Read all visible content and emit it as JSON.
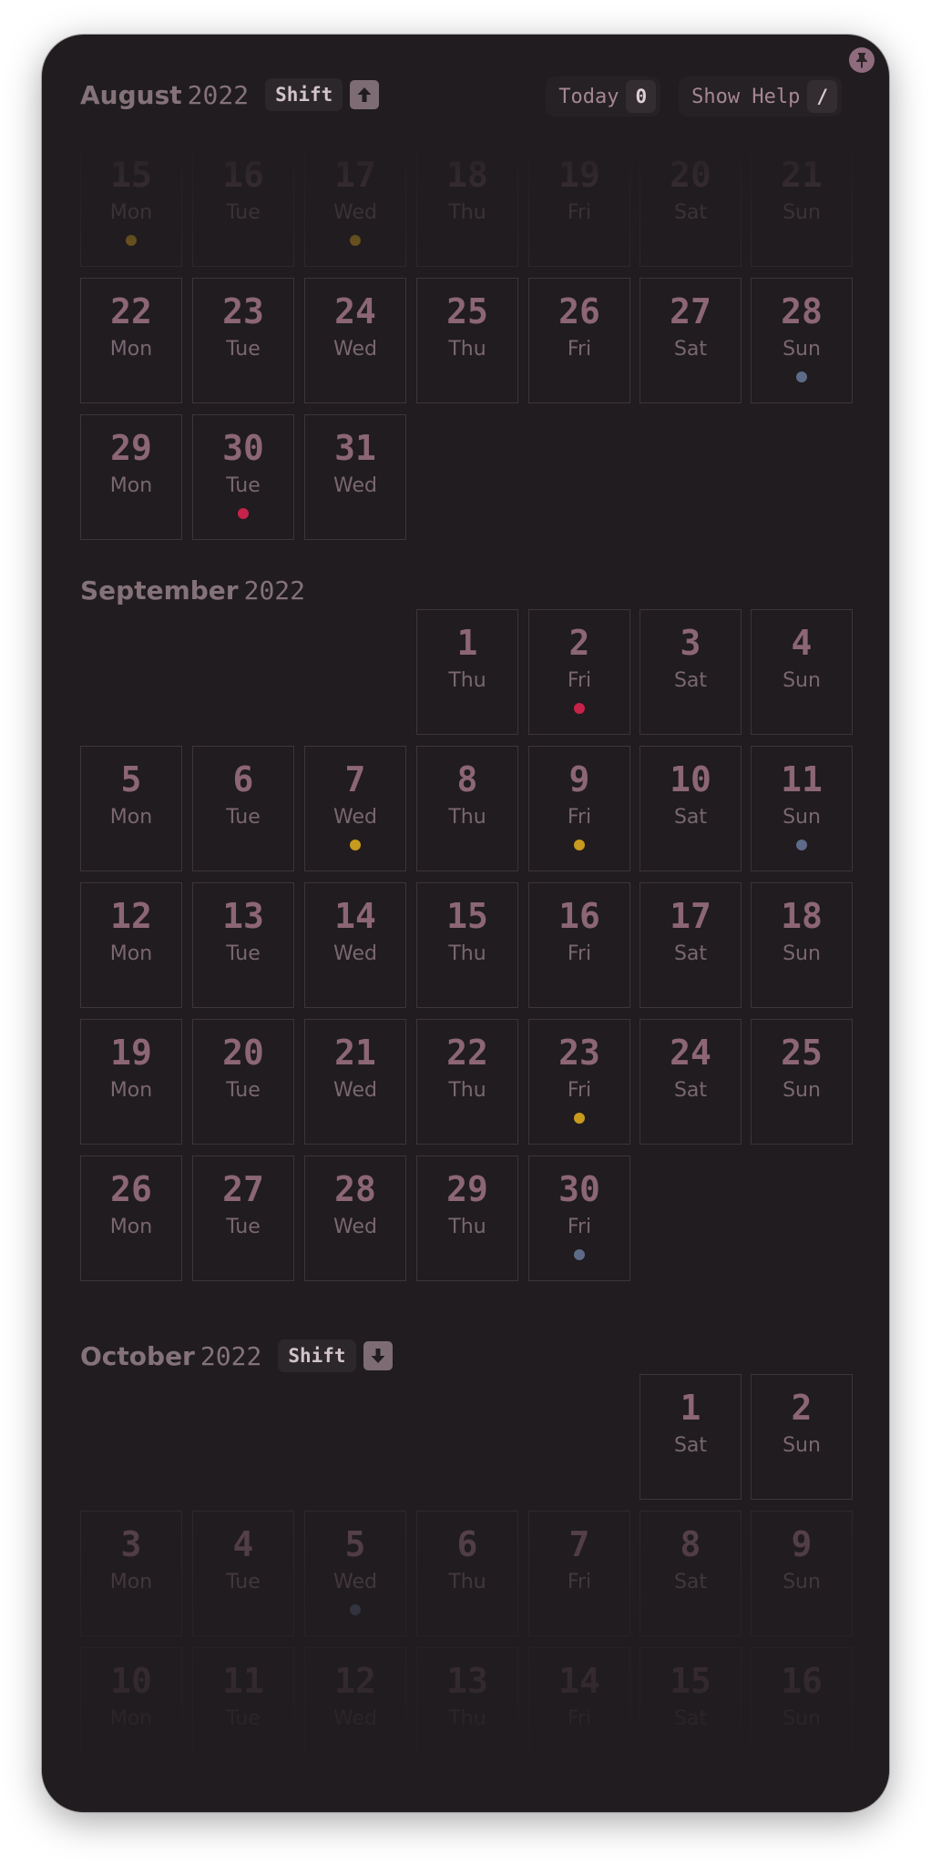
{
  "toolbar": {
    "today_label": "Today",
    "today_key": "0",
    "help_label": "Show Help",
    "help_key": "/"
  },
  "months": [
    {
      "name": "August",
      "year": "2022",
      "shift_label": "Shift",
      "shift_arrow": "arrow-up-icon"
    },
    {
      "name": "September",
      "year": "2022"
    },
    {
      "name": "October",
      "year": "2022",
      "shift_label": "Shift",
      "shift_arrow": "arrow-down-icon"
    }
  ],
  "event_colors": {
    "red": "#c7224a",
    "yellow": "#c89a1d",
    "slate": "#5d6b88"
  },
  "days": [
    {
      "m": 0,
      "d": "15",
      "w": "Mon",
      "dot": "yellow",
      "faded": true
    },
    {
      "m": 0,
      "d": "16",
      "w": "Tue",
      "faded": true
    },
    {
      "m": 0,
      "d": "17",
      "w": "Wed",
      "dot": "yellow",
      "faded": true
    },
    {
      "m": 0,
      "d": "18",
      "w": "Thu",
      "faded": true
    },
    {
      "m": 0,
      "d": "19",
      "w": "Fri",
      "faded": true
    },
    {
      "m": 0,
      "d": "20",
      "w": "Sat",
      "faded": true
    },
    {
      "m": 0,
      "d": "21",
      "w": "Sun",
      "faded": true
    },
    {
      "m": 0,
      "d": "22",
      "w": "Mon"
    },
    {
      "m": 0,
      "d": "23",
      "w": "Tue"
    },
    {
      "m": 0,
      "d": "24",
      "w": "Wed"
    },
    {
      "m": 0,
      "d": "25",
      "w": "Thu"
    },
    {
      "m": 0,
      "d": "26",
      "w": "Fri"
    },
    {
      "m": 0,
      "d": "27",
      "w": "Sat"
    },
    {
      "m": 0,
      "d": "28",
      "w": "Sun",
      "dot": "slate"
    },
    {
      "m": 0,
      "d": "29",
      "w": "Mon"
    },
    {
      "m": 0,
      "d": "30",
      "w": "Tue",
      "dot": "red"
    },
    {
      "m": 0,
      "d": "31",
      "w": "Wed"
    },
    {
      "m": 1,
      "d": "1",
      "w": "Thu"
    },
    {
      "m": 1,
      "d": "2",
      "w": "Fri",
      "dot": "red"
    },
    {
      "m": 1,
      "d": "3",
      "w": "Sat"
    },
    {
      "m": 1,
      "d": "4",
      "w": "Sun"
    },
    {
      "m": 1,
      "d": "5",
      "w": "Mon"
    },
    {
      "m": 1,
      "d": "6",
      "w": "Tue"
    },
    {
      "m": 1,
      "d": "7",
      "w": "Wed",
      "dot": "yellow"
    },
    {
      "m": 1,
      "d": "8",
      "w": "Thu"
    },
    {
      "m": 1,
      "d": "9",
      "w": "Fri",
      "dot": "yellow"
    },
    {
      "m": 1,
      "d": "10",
      "w": "Sat"
    },
    {
      "m": 1,
      "d": "11",
      "w": "Sun",
      "dot": "slate"
    },
    {
      "m": 1,
      "d": "12",
      "w": "Mon"
    },
    {
      "m": 1,
      "d": "13",
      "w": "Tue"
    },
    {
      "m": 1,
      "d": "14",
      "w": "Wed"
    },
    {
      "m": 1,
      "d": "15",
      "w": "Thu"
    },
    {
      "m": 1,
      "d": "16",
      "w": "Fri"
    },
    {
      "m": 1,
      "d": "17",
      "w": "Sat"
    },
    {
      "m": 1,
      "d": "18",
      "w": "Sun"
    },
    {
      "m": 1,
      "d": "19",
      "w": "Mon"
    },
    {
      "m": 1,
      "d": "20",
      "w": "Tue"
    },
    {
      "m": 1,
      "d": "21",
      "w": "Wed"
    },
    {
      "m": 1,
      "d": "22",
      "w": "Thu"
    },
    {
      "m": 1,
      "d": "23",
      "w": "Fri",
      "dot": "yellow"
    },
    {
      "m": 1,
      "d": "24",
      "w": "Sat"
    },
    {
      "m": 1,
      "d": "25",
      "w": "Sun"
    },
    {
      "m": 1,
      "d": "26",
      "w": "Mon"
    },
    {
      "m": 1,
      "d": "27",
      "w": "Tue"
    },
    {
      "m": 1,
      "d": "28",
      "w": "Wed"
    },
    {
      "m": 1,
      "d": "29",
      "w": "Thu"
    },
    {
      "m": 1,
      "d": "30",
      "w": "Fri",
      "dot": "slate"
    },
    {
      "m": 2,
      "d": "1",
      "w": "Sat"
    },
    {
      "m": 2,
      "d": "2",
      "w": "Sun"
    },
    {
      "m": 2,
      "d": "3",
      "w": "Mon",
      "faded": true
    },
    {
      "m": 2,
      "d": "4",
      "w": "Tue",
      "faded": true
    },
    {
      "m": 2,
      "d": "5",
      "w": "Wed",
      "dot": "slate",
      "faded": true
    },
    {
      "m": 2,
      "d": "6",
      "w": "Thu",
      "faded": true
    },
    {
      "m": 2,
      "d": "7",
      "w": "Fri",
      "faded": true
    },
    {
      "m": 2,
      "d": "8",
      "w": "Sat",
      "faded": true
    },
    {
      "m": 2,
      "d": "9",
      "w": "Sun",
      "faded": true
    },
    {
      "m": 2,
      "d": "10",
      "w": "Mon",
      "faded": true
    },
    {
      "m": 2,
      "d": "11",
      "w": "Tue",
      "faded": true
    },
    {
      "m": 2,
      "d": "12",
      "w": "Wed",
      "faded": true
    },
    {
      "m": 2,
      "d": "13",
      "w": "Thu",
      "faded": true
    },
    {
      "m": 2,
      "d": "14",
      "w": "Fri",
      "faded": true
    },
    {
      "m": 2,
      "d": "15",
      "w": "Sat",
      "faded": true
    },
    {
      "m": 2,
      "d": "16",
      "w": "Sun",
      "faded": true
    }
  ]
}
